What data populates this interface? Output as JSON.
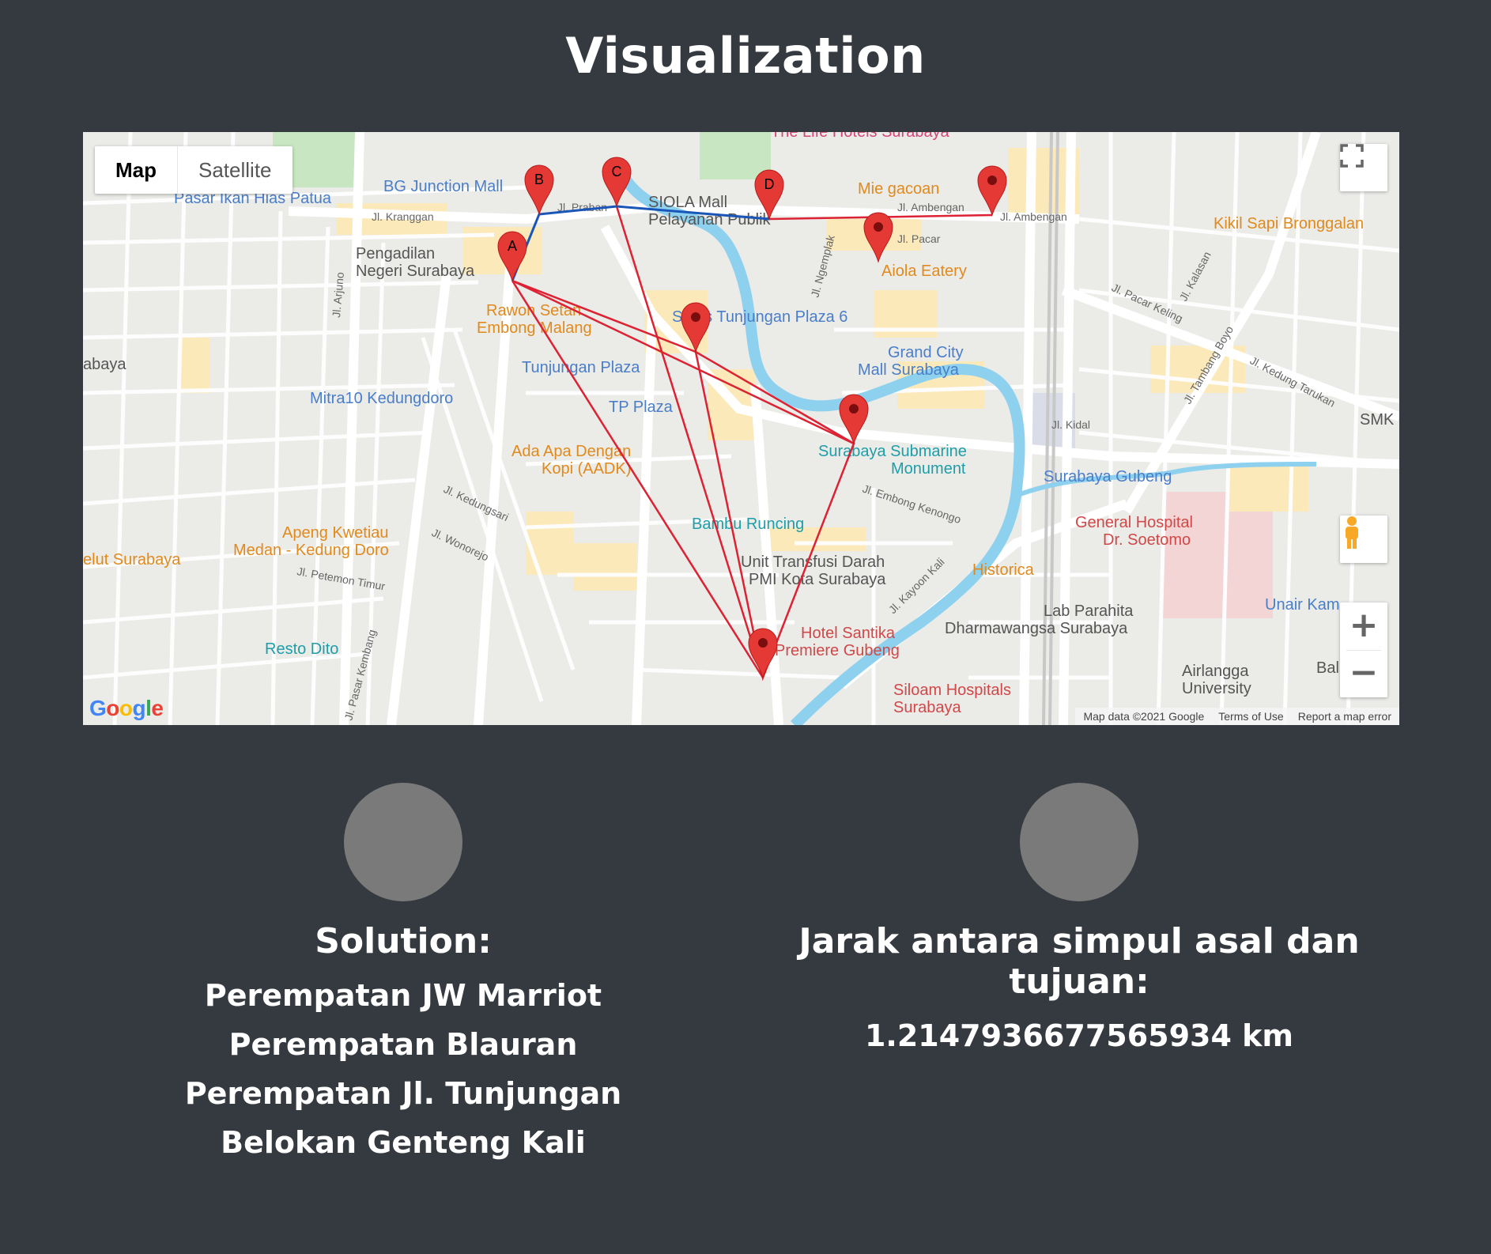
{
  "title": "Visualization",
  "map": {
    "map_types": [
      "Map",
      "Satellite"
    ],
    "active_map_type": "Map",
    "route_color": "#dc2233",
    "path_color": "#1a56b8",
    "marker_color": "#e53935",
    "markers": [
      {
        "id": "A",
        "label": "A"
      },
      {
        "id": "B",
        "label": "B"
      },
      {
        "id": "C",
        "label": "C"
      },
      {
        "id": "D",
        "label": "D"
      },
      {
        "id": "E",
        "label": ""
      },
      {
        "id": "F",
        "label": ""
      },
      {
        "id": "G",
        "label": ""
      },
      {
        "id": "H",
        "label": ""
      },
      {
        "id": "I",
        "label": ""
      }
    ],
    "places": [
      "BG Junction Mall",
      "Pasar Ikan Hias Patua",
      "SIOLA Mall Pelayanan Publik",
      "Mie gacoan",
      "Kikil Sapi Bronggalan",
      "Pengadilan Negeri Surabaya",
      "Aiola Eatery",
      "Rawon Setan Embong Malang",
      "Sutos Tunjungan Plaza 6",
      "Grand City Mall Surabaya",
      "Tunjungan Plaza",
      "Mitra10 Kedungdoro",
      "TP Plaza",
      "Surabaya Submarine Monument",
      "Ada Apa Dengan Kopi (AADK)",
      "Surabaya Gubeng",
      "Bambu Runcing",
      "General Hospital Dr. Soetomo",
      "Apeng Kwetiau Medan - Kedung Doro",
      "Unit Transfusi Darah PMI Kota Surabaya",
      "Historica",
      "Lab Parahita Dharmawangsa Surabaya",
      "Unair Kam",
      "Hotel Santika Premiere Gubeng",
      "Airlangga University",
      "Resto Dito",
      "Siloam Hospitals Surabaya",
      "Bali",
      "The Life Hotels Surabaya",
      "SMK"
    ],
    "streets": [
      "Jl. Kranggan",
      "Jl. Praban",
      "Jl. Ambengan",
      "Jl. Pacar Keling",
      "Jl. Kedung Tarukan",
      "Jl. Kalasan",
      "Jl. Tambang Boyo",
      "Jl. Arjuno",
      "Jl. Embong Kenongo",
      "Jl. Kayoon Kali",
      "Jl. Kedungsari",
      "Jl. Wonorejo",
      "Jl. Petemon Timur",
      "Jl. Pasar Kembang",
      "Jl. Ngemplak",
      "Jl. Pacar",
      "Jl. Kidal"
    ],
    "logo": "Google",
    "attribution": [
      "Map data ©2021 Google",
      "Terms of Use",
      "Report a map error"
    ]
  },
  "solution": {
    "heading": "Solution:",
    "path": [
      "Perempatan JW Marriot",
      "Perempatan Blauran",
      "Perempatan Jl. Tunjungan",
      "Belokan Genteng Kali"
    ]
  },
  "distance": {
    "heading": "Jarak antara simpul asal dan tujuan:",
    "value": "1.2147936677565934 km"
  }
}
